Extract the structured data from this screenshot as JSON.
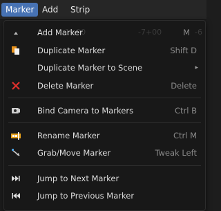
{
  "menubar": {
    "items": [
      {
        "label": "Marker"
      },
      {
        "label": "Add"
      },
      {
        "label": "Strip"
      }
    ]
  },
  "menu": {
    "add_marker": {
      "label": "Add Marker",
      "shortcut": "M",
      "ghost_left": "-1+00",
      "ghost_mid": "-7+00",
      "ghost_right": "-6"
    },
    "duplicate_marker": {
      "label": "Duplicate Marker",
      "shortcut": "Shift D"
    },
    "duplicate_marker_scene": {
      "label": "Duplicate Marker to Scene",
      "arrow": "▸"
    },
    "delete_marker": {
      "label": "Delete Marker",
      "shortcut": "Delete"
    },
    "bind_camera": {
      "label": "Bind Camera to Markers",
      "shortcut": "Ctrl B"
    },
    "rename_marker": {
      "label": "Rename Marker",
      "shortcut": "Ctrl M"
    },
    "grab_move_marker": {
      "label": "Grab/Move Marker",
      "shortcut": "Tweak Left"
    },
    "jump_next": {
      "label": "Jump to Next Marker"
    },
    "jump_prev": {
      "label": "Jump to Previous Marker"
    }
  },
  "colors": {
    "menubar_active": "#4772b3",
    "delete_icon": "#e0302c",
    "duplicate_icon": "#e8921c"
  }
}
